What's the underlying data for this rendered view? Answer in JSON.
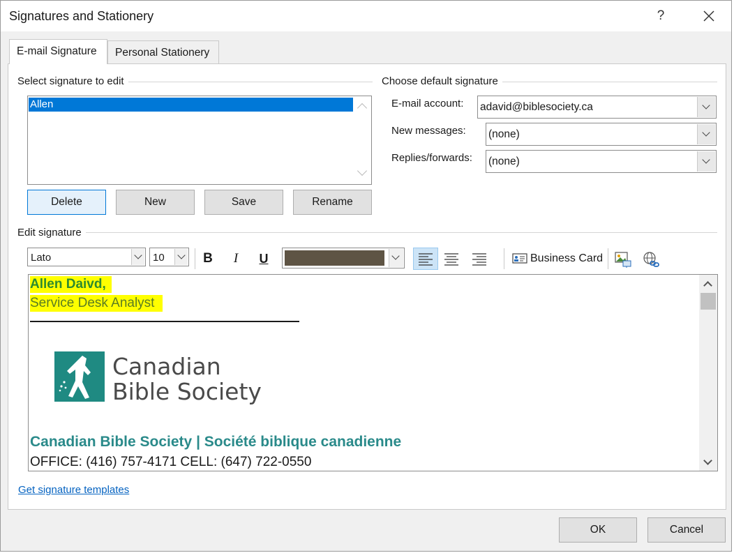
{
  "window": {
    "title": "Signatures and Stationery",
    "help_label": "?"
  },
  "tabs": [
    {
      "label": "E-mail Signature",
      "active": true
    },
    {
      "label": "Personal Stationery",
      "active": false
    }
  ],
  "select_signature": {
    "label": "Select signature to edit",
    "items": [
      "Allen"
    ],
    "selected": "Allen"
  },
  "signature_buttons": {
    "delete": "Delete",
    "new": "New",
    "save": "Save",
    "rename": "Rename"
  },
  "default_signature": {
    "label": "Choose default signature",
    "email_account_label": "E-mail account:",
    "email_account_value": "adavid@biblesociety.ca",
    "new_messages_label": "New messages:",
    "new_messages_value": "(none)",
    "replies_label": "Replies/forwards:",
    "replies_value": "(none)"
  },
  "edit_signature": {
    "label": "Edit signature",
    "font": "Lato",
    "size": "10",
    "color": "#5e5444",
    "bold": "B",
    "italic": "I",
    "underline": "U",
    "business_card": "Business Card",
    "icons": [
      "align-left-icon",
      "align-center-icon",
      "align-right-icon",
      "business-card-icon",
      "insert-picture-icon",
      "insert-hyperlink-icon"
    ]
  },
  "signature_content": {
    "name": "Allen Daivd,",
    "title": "Service Desk Analyst",
    "logo_line1": "Canadian",
    "logo_line2": "Bible Society",
    "organization": "Canadian Bible Society | Société biblique canadienne",
    "phones": "OFFICE: (416) 757-4171 CELL: (647) 722-0550"
  },
  "templates_link": "Get signature templates",
  "footer": {
    "ok": "OK",
    "cancel": "Cancel"
  },
  "colors": {
    "selection": "#0078d7",
    "highlight": "#ffff00",
    "name": "#2e8b2e",
    "org": "#2a8a8a",
    "logo_teal": "#1f8a82",
    "link": "#0563c1"
  }
}
